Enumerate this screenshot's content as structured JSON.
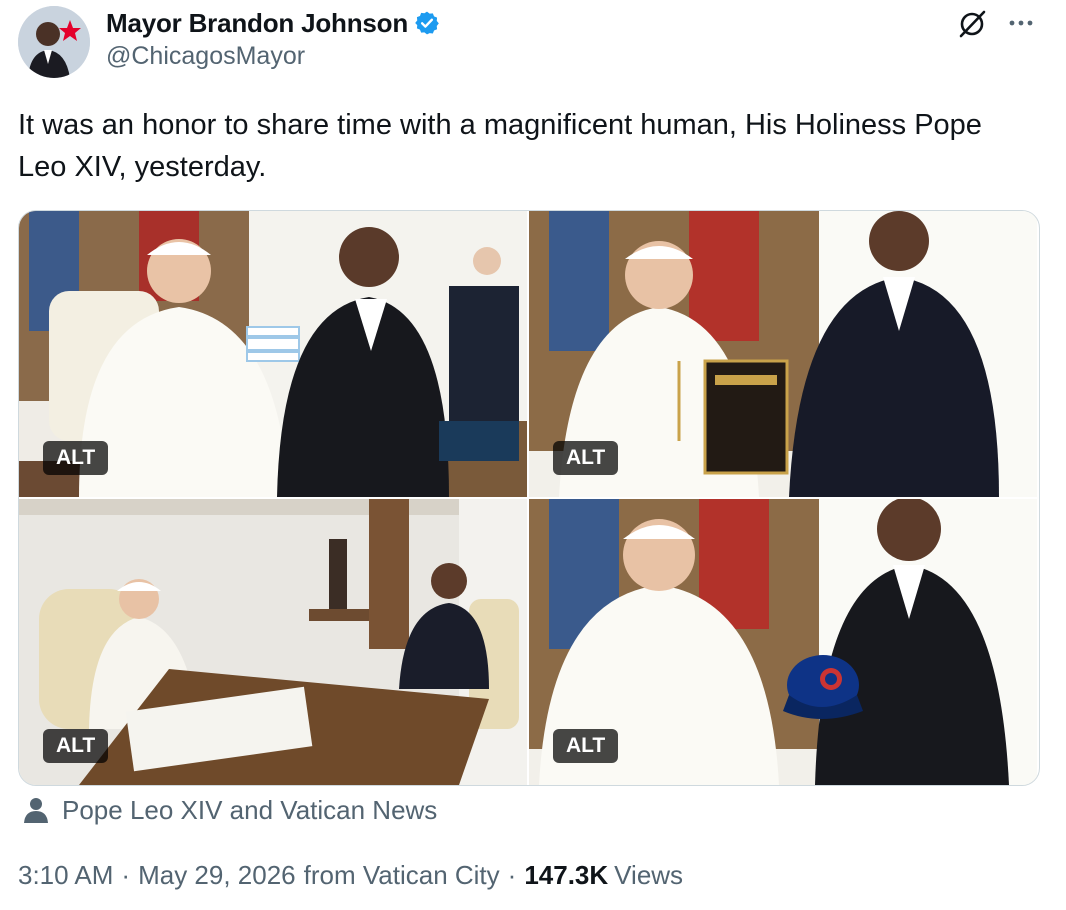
{
  "author": {
    "display_name": "Mayor Brandon Johnson",
    "handle": "@ChicagosMayor"
  },
  "tweet": {
    "text": "It was an honor to share time with a magnificent human, His Holiness Pope Leo XIV, yesterday."
  },
  "media": {
    "photos": [
      {
        "alt_label": "ALT",
        "subject": "pope and mayor holding chicago flag card"
      },
      {
        "alt_label": "ALT",
        "subject": "pope receiving key to the city plaque"
      },
      {
        "alt_label": "ALT",
        "subject": "pope and mayor seated at desk in library"
      },
      {
        "alt_label": "ALT",
        "subject": "pope and mayor holding cubs cap"
      }
    ]
  },
  "tagged": {
    "text": "Pope Leo XIV and Vatican News"
  },
  "meta": {
    "time": "3:10 AM",
    "separator": "·",
    "date": "May 29, 2026",
    "location": "from Vatican City",
    "views_count": "147.3K",
    "views_label": "Views"
  },
  "icons": {
    "verified": "verified-badge-icon",
    "grok": "grok-icon",
    "more": "more-options-icon",
    "tagged_person": "person-icon"
  },
  "colors": {
    "verified_blue": "#1d9bf0",
    "secondary_text": "#536471",
    "primary_text": "#0f1419",
    "border": "#cfd9de",
    "cubs_blue": "#0e3386",
    "cubs_red": "#cc3433"
  }
}
